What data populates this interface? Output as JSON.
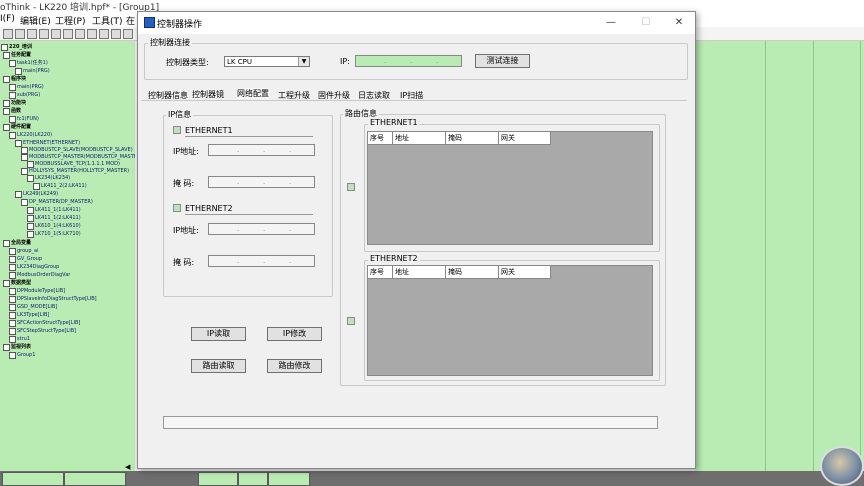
{
  "app": {
    "title": "oThink - LK220 培训.hpf* - [Group1]",
    "menu": [
      "I(F)",
      "编辑(E)",
      "工程(P)",
      "工具(T)",
      "在"
    ]
  },
  "tree": {
    "items": [
      {
        "label": "220_培训",
        "hdr": true
      },
      {
        "label": "任务配置",
        "hdr": true
      },
      {
        "label": "task1(任务1)"
      },
      {
        "label": "main(PRG)"
      },
      {
        "label": "程序块",
        "hdr": true
      },
      {
        "label": "main(PRG)"
      },
      {
        "label": "sub(PRG)"
      },
      {
        "label": "功能块",
        "hdr": true
      },
      {
        "label": "函数",
        "hdr": true
      },
      {
        "label": "fc1(FUN)"
      },
      {
        "label": "硬件配置",
        "hdr": true
      },
      {
        "label": "LK220(LK220)"
      },
      {
        "label": "ETHERNET(ETHERNET)"
      },
      {
        "label": "MODBUSTCP_SLAVE(MODBUSTCP_SLAVE)"
      },
      {
        "label": "MODBUSTCP_MASTER(MODBUSTCP_MASTER)"
      },
      {
        "label": "MODBUSSLAVE_TCP(1.1.1.1 MOD)"
      },
      {
        "label": "HOLLYSYS_MASTER(HOLLYTCP_MASTER)"
      },
      {
        "label": "LK234(LK234)"
      },
      {
        "label": "LK411_2(2:LK411)"
      },
      {
        "label": "LK249(LK249)"
      },
      {
        "label": "DP_MASTER(DP_MASTER)"
      },
      {
        "label": "LK411_1(1:LK411)"
      },
      {
        "label": "LK411_1(2:LK411)"
      },
      {
        "label": "LK610_1(4:LK610)"
      },
      {
        "label": "LK710_1(5:LK710)"
      },
      {
        "label": "全局变量",
        "hdr": true
      },
      {
        "label": "group_ai"
      },
      {
        "label": "GV_Group"
      },
      {
        "label": "LK234DiagGroup"
      },
      {
        "label": "ModbusOrderDiagVar"
      },
      {
        "label": "数据类型",
        "hdr": true
      },
      {
        "label": "DPModuleType[LIB]"
      },
      {
        "label": "DPSlaveInfoDiagStructType[LIB]"
      },
      {
        "label": "GSD_MODE[LIB]"
      },
      {
        "label": "LK3Type[LIB]"
      },
      {
        "label": "SFCActionStructType[LIB]"
      },
      {
        "label": "SFCStepStructType[LIB]"
      },
      {
        "label": "stru1"
      },
      {
        "label": "监视列表",
        "hdr": true
      },
      {
        "label": "Group1"
      }
    ]
  },
  "dialog": {
    "title": "控制器操作",
    "connection_group": "控制器连接",
    "controller_type_label": "控制器类型:",
    "controller_type_value": "LK CPU",
    "ip_label": "IP:",
    "test_button": "测试连接",
    "tabs": [
      "控制器信息",
      "控制器镜",
      "网络配置",
      "工程升级",
      "固件升级",
      "日志读取",
      "IP扫描"
    ],
    "ip_info_group": "IP信息",
    "eth1_label": "ETHERNET1",
    "eth2_label": "ETHERNET2",
    "ip_addr_label": "IP地址:",
    "mask_label": "掩    码:",
    "ip_read_button": "IP读取",
    "ip_modify_button": "IP修改",
    "route_read_button": "路由读取",
    "route_modify_button": "路由修改",
    "route_info_group": "路由信息",
    "route_columns": [
      "序号",
      "地址",
      "掩码",
      "网关"
    ]
  }
}
